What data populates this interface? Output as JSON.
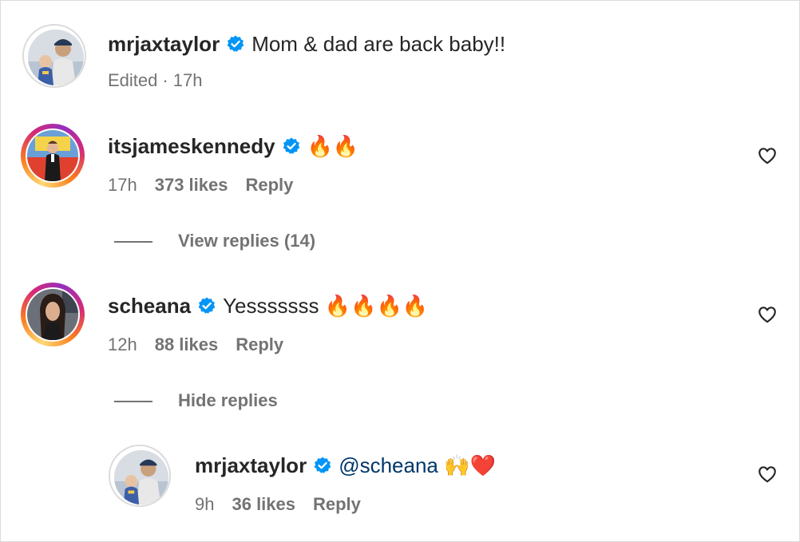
{
  "comments": [
    {
      "username": "mrjaxtaylor",
      "text": "Mom & dad are back baby!!",
      "edited": "Edited",
      "sep": "·",
      "time": "17h"
    },
    {
      "username": "itsjameskennedy",
      "text": "🔥🔥",
      "time": "17h",
      "likes": "373 likes",
      "reply": "Reply",
      "replies_toggle": "View replies (14)"
    },
    {
      "username": "scheana",
      "text": "Yesssssss 🔥🔥🔥🔥",
      "time": "12h",
      "likes": "88 likes",
      "reply": "Reply",
      "replies_toggle": "Hide replies"
    },
    {
      "username": "mrjaxtaylor",
      "mention": "@scheana",
      "text": "🙌❤️",
      "time": "9h",
      "likes": "36 likes",
      "reply": "Reply"
    }
  ],
  "icons": {
    "verified": "verified-badge-icon",
    "like": "heart-outline-icon"
  },
  "colors": {
    "verified": "#0095f6",
    "meta": "#737373",
    "mention": "#00376b",
    "story_ring_start": "#feda75",
    "story_ring_end": "#962fbf"
  }
}
